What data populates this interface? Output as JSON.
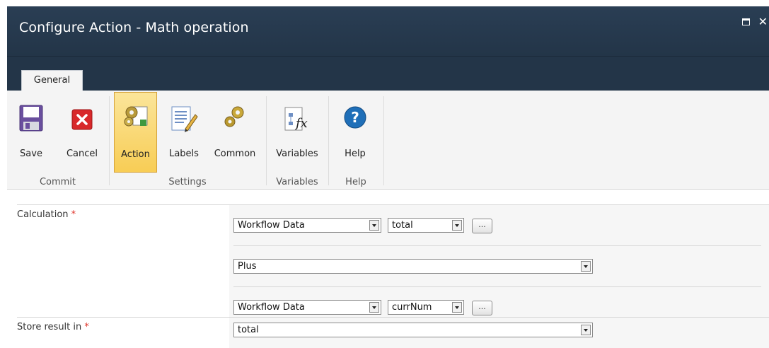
{
  "window": {
    "title": "Configure Action - Math operation"
  },
  "tabs": [
    {
      "label": "General"
    }
  ],
  "ribbon": {
    "groups": [
      {
        "label": "Commit",
        "buttons": [
          {
            "label": "Save",
            "icon": "save-icon"
          },
          {
            "label": "Cancel",
            "icon": "cancel-icon"
          }
        ]
      },
      {
        "label": "Settings",
        "buttons": [
          {
            "label": "Action",
            "icon": "action-gears-icon",
            "selected": true
          },
          {
            "label": "Labels",
            "icon": "labels-icon"
          },
          {
            "label": "Common",
            "icon": "common-gears-icon"
          }
        ]
      },
      {
        "label": "Variables",
        "buttons": [
          {
            "label": "Variables",
            "icon": "variables-fx-icon"
          }
        ]
      },
      {
        "label": "Help",
        "buttons": [
          {
            "label": "Help",
            "icon": "help-icon"
          }
        ]
      }
    ]
  },
  "form": {
    "calculation": {
      "label": "Calculation",
      "required_mark": "*",
      "operand1": {
        "source": "Workflow Data",
        "value": "total",
        "ellipsis": "..."
      },
      "operator": "Plus",
      "operand2": {
        "source": "Workflow Data",
        "value": "currNum",
        "ellipsis": "..."
      }
    },
    "store_result": {
      "label": "Store result in",
      "required_mark": "*",
      "value": "total"
    }
  },
  "colors": {
    "titlebar": "#233548",
    "ribbon_bg": "#f4f4f4",
    "selected_button": "#f8cd55",
    "required": "#e0352b"
  }
}
